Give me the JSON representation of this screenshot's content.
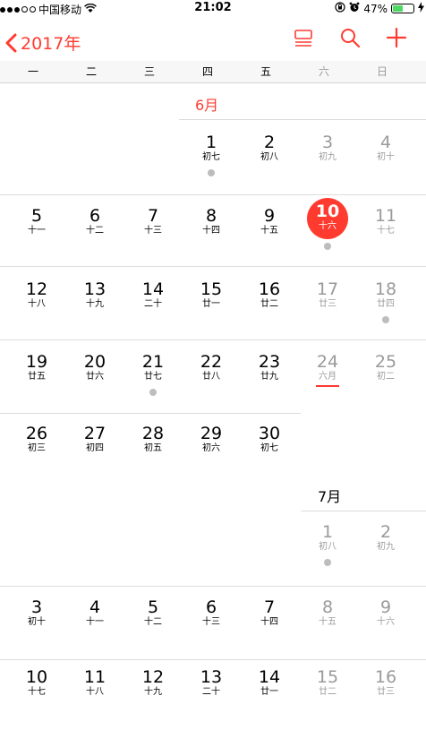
{
  "status": {
    "carrier": "中国移动",
    "time": "21:02",
    "battery": "47%",
    "battery_level": 0.47
  },
  "nav": {
    "back_label": "2017年"
  },
  "weekdays": [
    "一",
    "二",
    "三",
    "四",
    "五",
    "六",
    "日"
  ],
  "months": [
    {
      "label": "6月",
      "days": [
        {
          "num": "1",
          "lunar": "初七",
          "event": true
        },
        {
          "num": "2",
          "lunar": "初八"
        },
        {
          "num": "3",
          "lunar": "初九"
        },
        {
          "num": "4",
          "lunar": "初十"
        },
        {
          "num": "5",
          "lunar": "十一"
        },
        {
          "num": "6",
          "lunar": "十二"
        },
        {
          "num": "7",
          "lunar": "十三"
        },
        {
          "num": "8",
          "lunar": "十四"
        },
        {
          "num": "9",
          "lunar": "十五"
        },
        {
          "num": "10",
          "lunar": "十六",
          "event": true,
          "today": true
        },
        {
          "num": "11",
          "lunar": "十七"
        },
        {
          "num": "12",
          "lunar": "十八"
        },
        {
          "num": "13",
          "lunar": "十九"
        },
        {
          "num": "14",
          "lunar": "二十"
        },
        {
          "num": "15",
          "lunar": "廿一"
        },
        {
          "num": "16",
          "lunar": "廿二"
        },
        {
          "num": "17",
          "lunar": "廿三"
        },
        {
          "num": "18",
          "lunar": "廿四",
          "event": true
        },
        {
          "num": "19",
          "lunar": "廿五"
        },
        {
          "num": "20",
          "lunar": "廿六"
        },
        {
          "num": "21",
          "lunar": "廿七",
          "event": true
        },
        {
          "num": "22",
          "lunar": "廿八"
        },
        {
          "num": "23",
          "lunar": "廿九"
        },
        {
          "num": "24",
          "lunar": "六月",
          "underline": true
        },
        {
          "num": "25",
          "lunar": "初二"
        },
        {
          "num": "26",
          "lunar": "初三"
        },
        {
          "num": "27",
          "lunar": "初四"
        },
        {
          "num": "28",
          "lunar": "初五"
        },
        {
          "num": "29",
          "lunar": "初六"
        },
        {
          "num": "30",
          "lunar": "初七"
        }
      ]
    },
    {
      "label": "7月",
      "days": [
        {
          "num": "1",
          "lunar": "初八",
          "event": true
        },
        {
          "num": "2",
          "lunar": "初九"
        },
        {
          "num": "3",
          "lunar": "初十"
        },
        {
          "num": "4",
          "lunar": "十一"
        },
        {
          "num": "5",
          "lunar": "十二"
        },
        {
          "num": "6",
          "lunar": "十三"
        },
        {
          "num": "7",
          "lunar": "十四"
        },
        {
          "num": "8",
          "lunar": "十五"
        },
        {
          "num": "9",
          "lunar": "十六"
        },
        {
          "num": "10",
          "lunar": "十七"
        },
        {
          "num": "11",
          "lunar": "十八"
        },
        {
          "num": "12",
          "lunar": "十九"
        },
        {
          "num": "13",
          "lunar": "二十"
        },
        {
          "num": "14",
          "lunar": "廿一"
        },
        {
          "num": "15",
          "lunar": "廿二"
        },
        {
          "num": "16",
          "lunar": "廿三"
        }
      ]
    }
  ],
  "colors": {
    "accent": "#ff3b30",
    "weekend_text": "#9a9a9a",
    "event_dot": "#bdbdbd",
    "battery": "#4cd964"
  }
}
